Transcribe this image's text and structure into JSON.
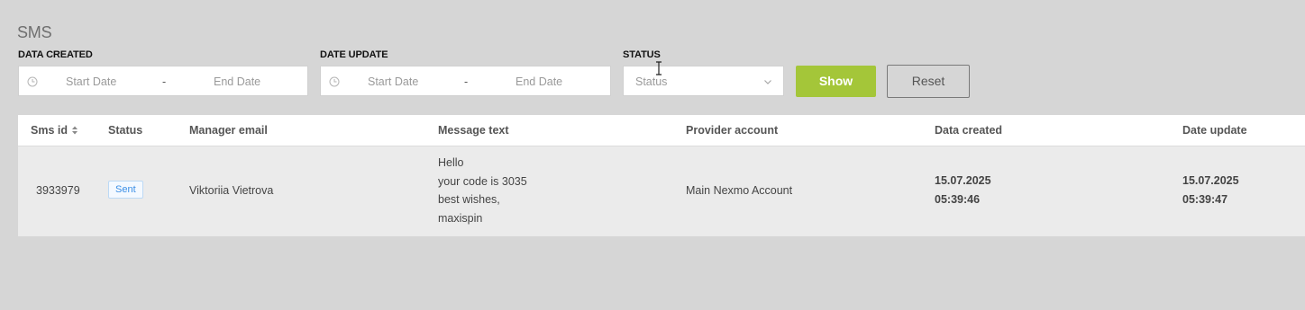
{
  "page": {
    "title": "SMS"
  },
  "filters": {
    "data_created": {
      "label": "DATA CREATED",
      "start_placeholder": "Start Date",
      "separator": "-",
      "end_placeholder": "End Date"
    },
    "date_update": {
      "label": "DATE UPDATE",
      "start_placeholder": "Start Date",
      "separator": "-",
      "end_placeholder": "End Date"
    },
    "status": {
      "label": "STATUS",
      "placeholder": "Status"
    },
    "show_label": "Show",
    "reset_label": "Reset"
  },
  "table": {
    "columns": {
      "sms_id": "Sms id",
      "status": "Status",
      "manager_email": "Manager email",
      "message_text": "Message text",
      "provider_account": "Provider account",
      "data_created": "Data created",
      "date_update": "Date update"
    },
    "rows": [
      {
        "sms_id": "3933979",
        "status": "Sent",
        "manager_email": "Viktoriia Vietrova",
        "message_lines": [
          "Hello",
          "your code is 3035",
          "best wishes,",
          "maxispin"
        ],
        "provider_account": "Main Nexmo Account",
        "data_created_date": "15.07.2025",
        "data_created_time": "05:39:46",
        "date_update_date": "15.07.2025",
        "date_update_time": "05:39:47"
      }
    ]
  },
  "colors": {
    "background": "#d6d6d6",
    "accent_green": "#a4c639",
    "badge_blue": "#3a8ee6"
  }
}
